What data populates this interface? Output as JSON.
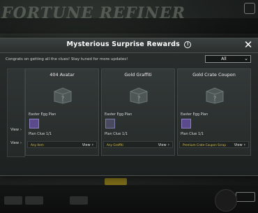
{
  "background": {
    "logo_text": "FORTUNE REFINER"
  },
  "modal": {
    "title": "Mysterious Surprise Rewards",
    "congrats": "Congrats on getting all the clues! Stay tuned for more updates!",
    "filter": {
      "selected": "All"
    },
    "left_views": [
      "View",
      "View"
    ],
    "cards": [
      {
        "title": "404 Avatar",
        "egg_label": "Easter Egg Plan",
        "plan_label": "Plan Clue 1/1",
        "item_text": "Any item",
        "view_label": "View"
      },
      {
        "title": "Gold Graffiti",
        "egg_label": "Easter Egg Plan",
        "plan_label": "Plan Clue 1/1",
        "item_text": "Any Graffiti",
        "view_label": "View"
      },
      {
        "title": "Gold Crate Coupon",
        "egg_label": "Easter Egg Plan",
        "plan_label": "Plan Clue 1/1",
        "item_text": "Premium Crate Coupon Scrap",
        "view_label": "View"
      }
    ]
  },
  "icons": {
    "info": "info-icon",
    "close": "close-icon",
    "dropdown": "chevron-down-icon",
    "reward": "mystery-box-icon",
    "view_arrow": "chevron-right-icon"
  },
  "colors": {
    "highlight_text": "#d8c24a",
    "panel": "#2a2f2e"
  }
}
